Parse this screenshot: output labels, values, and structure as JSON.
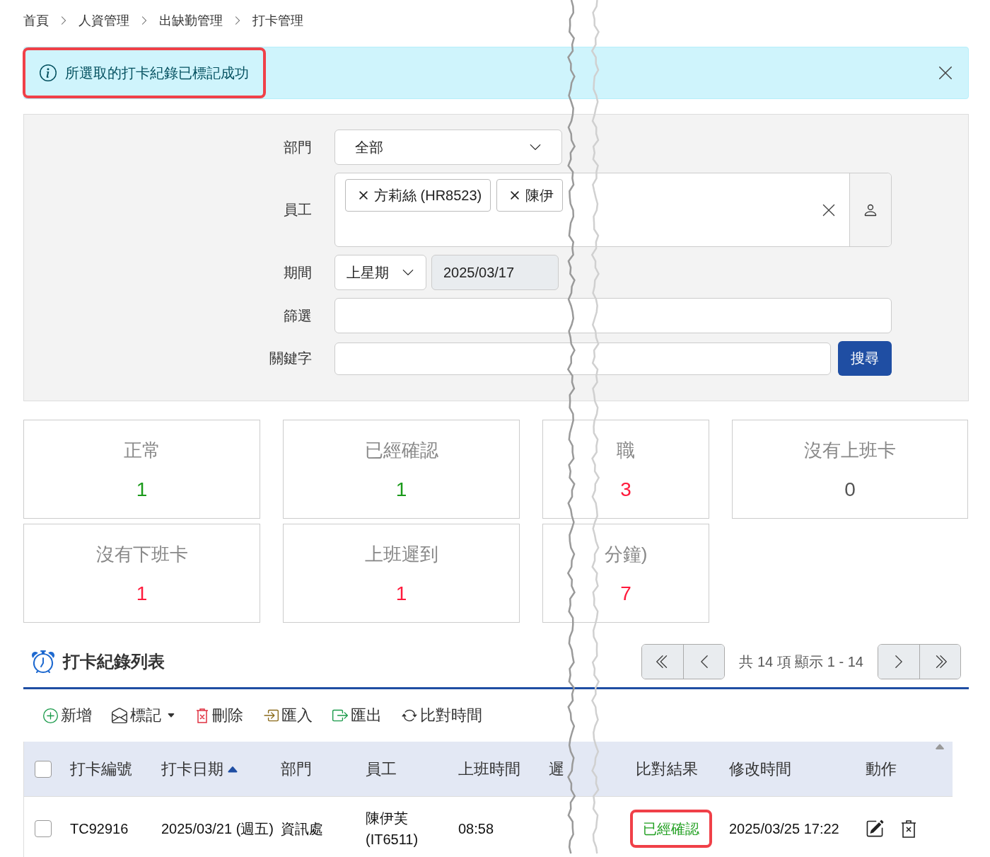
{
  "breadcrumb": [
    "首頁",
    "人資管理",
    "出缺勤管理",
    "打卡管理"
  ],
  "alert": {
    "message": "所選取的打卡紀錄已標記成功",
    "highlighted": true
  },
  "filters": {
    "department": {
      "label": "部門",
      "value": "全部"
    },
    "employee": {
      "label": "員工",
      "tags": [
        "方莉絲 (HR8523)",
        "陳伊"
      ]
    },
    "period": {
      "label": "期間",
      "preset": "上星期",
      "date": "2025/03/17"
    },
    "filter": {
      "label": "篩選"
    },
    "keyword": {
      "label": "關鍵字",
      "button": "搜尋"
    }
  },
  "stats": [
    {
      "label": "正常",
      "value": "1",
      "color": "#1a9a1a"
    },
    {
      "label": "已經確認",
      "value": "1",
      "color": "#1a9a1a"
    },
    {
      "label": "職",
      "value": "3",
      "color": "#ff1a3c"
    },
    {
      "label": "沒有上班卡",
      "value": "0",
      "color": "#555555"
    },
    {
      "label": "沒有下班卡",
      "value": "1",
      "color": "#ff1a3c"
    },
    {
      "label": "上班遲到",
      "value": "1",
      "color": "#ff1a3c"
    },
    {
      "label": "分鐘)",
      "value": "7",
      "color": "#ff1a3c"
    }
  ],
  "list": {
    "title": "打卡紀錄列表",
    "pagination": {
      "summary": "共 14 項 顯示 1 - 14"
    },
    "toolbar": [
      {
        "kind": "add",
        "label": "新增"
      },
      {
        "kind": "mark",
        "label": "標記"
      },
      {
        "kind": "delete",
        "label": "刪除"
      },
      {
        "kind": "import",
        "label": "匯入"
      },
      {
        "kind": "export",
        "label": "匯出"
      },
      {
        "kind": "compare",
        "label": "比對時間"
      }
    ],
    "select_all": {
      "checked": false
    },
    "columns": [
      {
        "label": "打卡編號",
        "sorted": false
      },
      {
        "label": "打卡日期",
        "sorted": true
      },
      {
        "label": "部門",
        "sorted": false
      },
      {
        "label": "員工",
        "sorted": false
      },
      {
        "label": "上班時間",
        "sorted": false
      },
      {
        "label": "遲",
        "sorted": false
      },
      {
        "label": "比對結果",
        "sorted": false
      },
      {
        "label": "修改時間",
        "sorted": false
      },
      {
        "label": "動作",
        "sorted": false
      }
    ],
    "rows": [
      {
        "checked": false,
        "id": "TC92916",
        "date": "2025/03/21 (週五)",
        "department": "資訊處",
        "employee": "陳伊芙 (IT6511)",
        "clock_in": "08:58",
        "result": "已經確認",
        "result_highlighted": true,
        "modified": "2025/03/25 17:22"
      }
    ]
  }
}
